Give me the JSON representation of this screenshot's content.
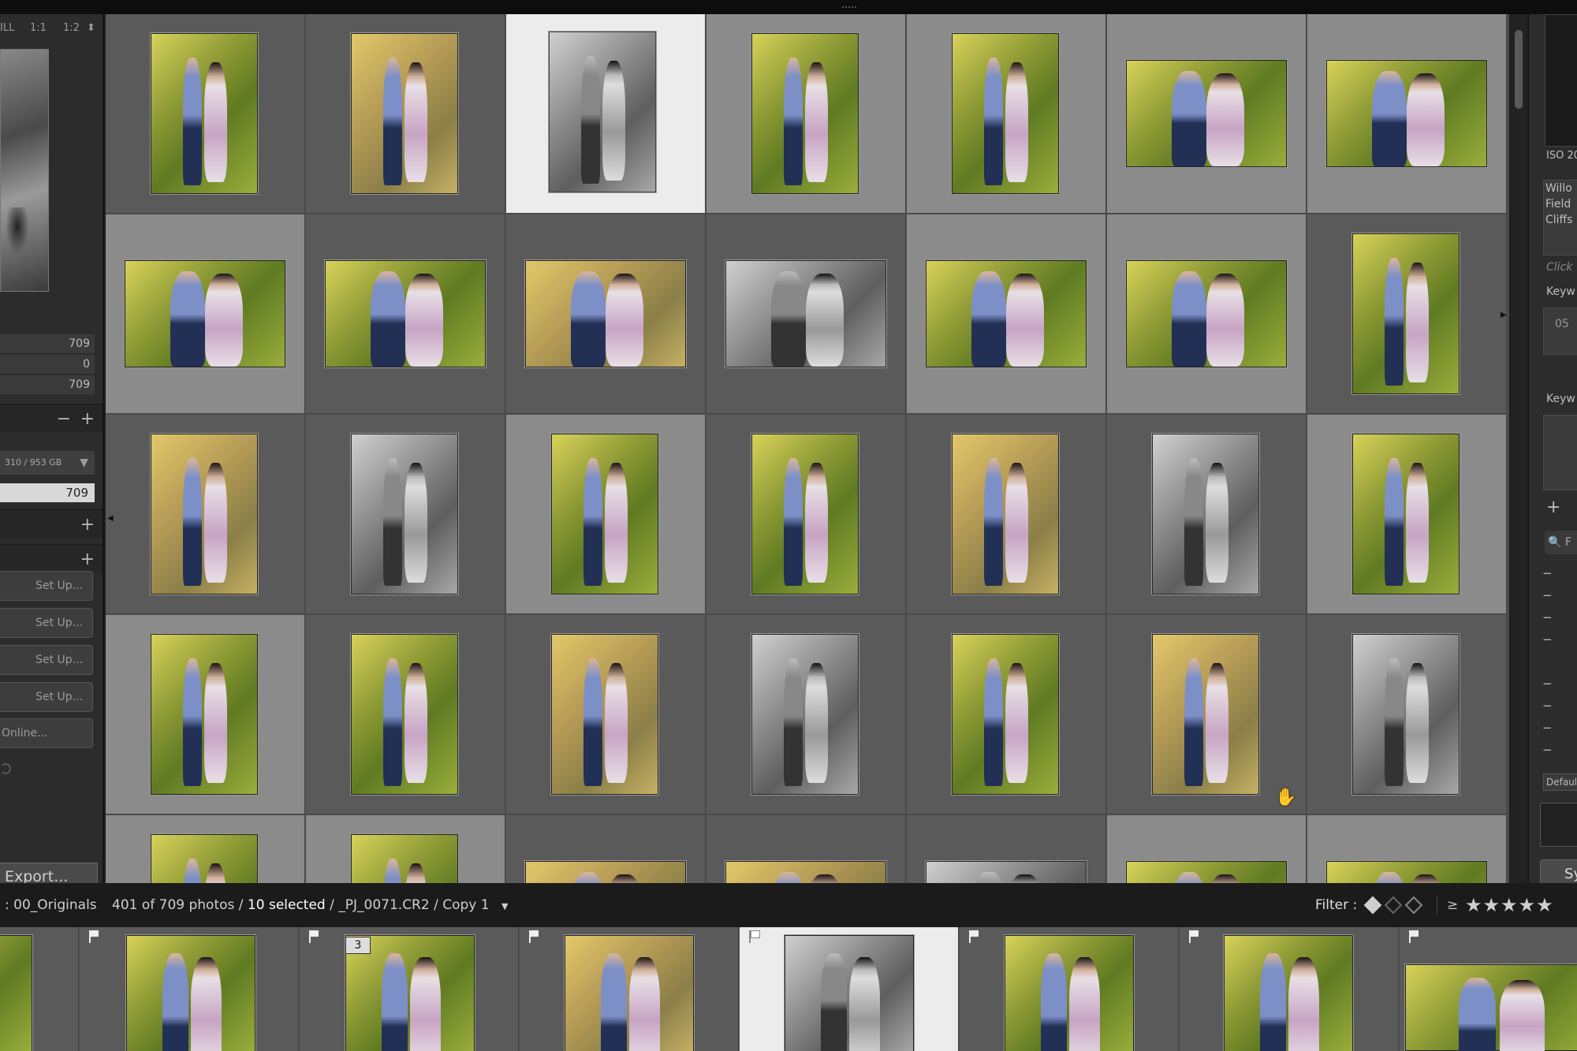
{
  "left_panel": {
    "zoom_options": [
      "ILL",
      "1:1",
      "1:2"
    ],
    "zoom_arrows": "⬍",
    "counts": [
      "709",
      "0",
      "709"
    ],
    "minus": "−",
    "plus": "+",
    "volume_label": "310 / 953 GB",
    "volume_arrow": "▼",
    "volume_count": "709",
    "setup_buttons": [
      "Set Up...",
      "Set Up...",
      "Set Up...",
      "Set Up..."
    ],
    "online_button": "Online...",
    "export_button": "Export..."
  },
  "right_panel": {
    "histogram_iso": "ISO 20",
    "location_lines": [
      "Willo",
      "Field",
      "Cliffs"
    ],
    "click_placeholder": "Click",
    "keyword_label_1": "Keyw",
    "keyword_value": "05",
    "keyword_label_2": "Keyw",
    "add": "+",
    "search_placeholder": "F",
    "keyword_rows": [
      "−",
      "−",
      "−",
      "−",
      "",
      "−",
      "−",
      "−",
      "−"
    ],
    "default_button": "Defaul",
    "sync_button": "Sy"
  },
  "status_bar": {
    "folder": ": 00_Originals",
    "photo_count": "401 of 709 photos /",
    "selected": "10 selected",
    "file": "/ _PJ_0071.CR2 / Copy 1",
    "file_caret": "▼",
    "filter_label": "Filter :",
    "rating_op": "≥",
    "stars": "★★★★★"
  },
  "filmstrip": {
    "stack_count": "3"
  },
  "colors": {
    "selected_cell": "#ececec",
    "light_cell": "#8b8b8b",
    "dark_cell": "#5a5a5a",
    "panel_bg": "#2c2c2c"
  }
}
